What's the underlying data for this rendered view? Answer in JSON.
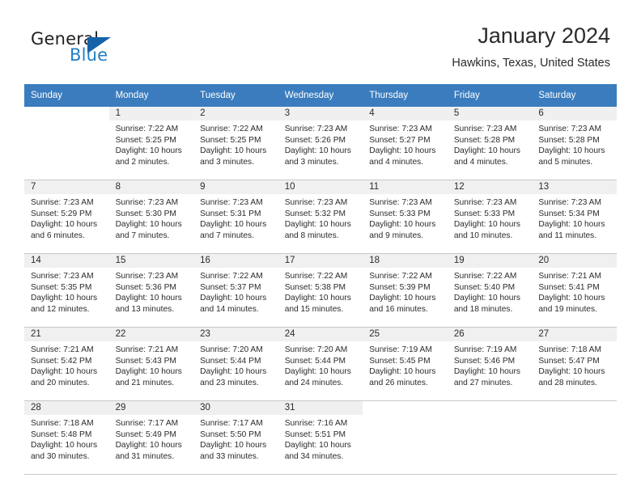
{
  "brand": {
    "name_top": "General",
    "name_bottom": "Blue",
    "triangle_color": "#1463a8",
    "blue_color": "#1f7fc4"
  },
  "header": {
    "title": "January 2024",
    "subtitle": "Hawkins, Texas, United States",
    "header_bg": "#3a7cbe",
    "header_text_color": "#ffffff"
  },
  "weekdays": [
    "Sunday",
    "Monday",
    "Tuesday",
    "Wednesday",
    "Thursday",
    "Friday",
    "Saturday"
  ],
  "labels": {
    "sunrise": "Sunrise:",
    "sunset": "Sunset:",
    "daylight": "Daylight:"
  },
  "weeks": [
    [
      {
        "day": ""
      },
      {
        "day": "1",
        "sunrise": "Sunrise: 7:22 AM",
        "sunset": "Sunset: 5:25 PM",
        "daylight": "Daylight: 10 hours and 2 minutes."
      },
      {
        "day": "2",
        "sunrise": "Sunrise: 7:22 AM",
        "sunset": "Sunset: 5:25 PM",
        "daylight": "Daylight: 10 hours and 3 minutes."
      },
      {
        "day": "3",
        "sunrise": "Sunrise: 7:23 AM",
        "sunset": "Sunset: 5:26 PM",
        "daylight": "Daylight: 10 hours and 3 minutes."
      },
      {
        "day": "4",
        "sunrise": "Sunrise: 7:23 AM",
        "sunset": "Sunset: 5:27 PM",
        "daylight": "Daylight: 10 hours and 4 minutes."
      },
      {
        "day": "5",
        "sunrise": "Sunrise: 7:23 AM",
        "sunset": "Sunset: 5:28 PM",
        "daylight": "Daylight: 10 hours and 4 minutes."
      },
      {
        "day": "6",
        "sunrise": "Sunrise: 7:23 AM",
        "sunset": "Sunset: 5:28 PM",
        "daylight": "Daylight: 10 hours and 5 minutes."
      }
    ],
    [
      {
        "day": "7",
        "sunrise": "Sunrise: 7:23 AM",
        "sunset": "Sunset: 5:29 PM",
        "daylight": "Daylight: 10 hours and 6 minutes."
      },
      {
        "day": "8",
        "sunrise": "Sunrise: 7:23 AM",
        "sunset": "Sunset: 5:30 PM",
        "daylight": "Daylight: 10 hours and 7 minutes."
      },
      {
        "day": "9",
        "sunrise": "Sunrise: 7:23 AM",
        "sunset": "Sunset: 5:31 PM",
        "daylight": "Daylight: 10 hours and 7 minutes."
      },
      {
        "day": "10",
        "sunrise": "Sunrise: 7:23 AM",
        "sunset": "Sunset: 5:32 PM",
        "daylight": "Daylight: 10 hours and 8 minutes."
      },
      {
        "day": "11",
        "sunrise": "Sunrise: 7:23 AM",
        "sunset": "Sunset: 5:33 PM",
        "daylight": "Daylight: 10 hours and 9 minutes."
      },
      {
        "day": "12",
        "sunrise": "Sunrise: 7:23 AM",
        "sunset": "Sunset: 5:33 PM",
        "daylight": "Daylight: 10 hours and 10 minutes."
      },
      {
        "day": "13",
        "sunrise": "Sunrise: 7:23 AM",
        "sunset": "Sunset: 5:34 PM",
        "daylight": "Daylight: 10 hours and 11 minutes."
      }
    ],
    [
      {
        "day": "14",
        "sunrise": "Sunrise: 7:23 AM",
        "sunset": "Sunset: 5:35 PM",
        "daylight": "Daylight: 10 hours and 12 minutes."
      },
      {
        "day": "15",
        "sunrise": "Sunrise: 7:23 AM",
        "sunset": "Sunset: 5:36 PM",
        "daylight": "Daylight: 10 hours and 13 minutes."
      },
      {
        "day": "16",
        "sunrise": "Sunrise: 7:22 AM",
        "sunset": "Sunset: 5:37 PM",
        "daylight": "Daylight: 10 hours and 14 minutes."
      },
      {
        "day": "17",
        "sunrise": "Sunrise: 7:22 AM",
        "sunset": "Sunset: 5:38 PM",
        "daylight": "Daylight: 10 hours and 15 minutes."
      },
      {
        "day": "18",
        "sunrise": "Sunrise: 7:22 AM",
        "sunset": "Sunset: 5:39 PM",
        "daylight": "Daylight: 10 hours and 16 minutes."
      },
      {
        "day": "19",
        "sunrise": "Sunrise: 7:22 AM",
        "sunset": "Sunset: 5:40 PM",
        "daylight": "Daylight: 10 hours and 18 minutes."
      },
      {
        "day": "20",
        "sunrise": "Sunrise: 7:21 AM",
        "sunset": "Sunset: 5:41 PM",
        "daylight": "Daylight: 10 hours and 19 minutes."
      }
    ],
    [
      {
        "day": "21",
        "sunrise": "Sunrise: 7:21 AM",
        "sunset": "Sunset: 5:42 PM",
        "daylight": "Daylight: 10 hours and 20 minutes."
      },
      {
        "day": "22",
        "sunrise": "Sunrise: 7:21 AM",
        "sunset": "Sunset: 5:43 PM",
        "daylight": "Daylight: 10 hours and 21 minutes."
      },
      {
        "day": "23",
        "sunrise": "Sunrise: 7:20 AM",
        "sunset": "Sunset: 5:44 PM",
        "daylight": "Daylight: 10 hours and 23 minutes."
      },
      {
        "day": "24",
        "sunrise": "Sunrise: 7:20 AM",
        "sunset": "Sunset: 5:44 PM",
        "daylight": "Daylight: 10 hours and 24 minutes."
      },
      {
        "day": "25",
        "sunrise": "Sunrise: 7:19 AM",
        "sunset": "Sunset: 5:45 PM",
        "daylight": "Daylight: 10 hours and 26 minutes."
      },
      {
        "day": "26",
        "sunrise": "Sunrise: 7:19 AM",
        "sunset": "Sunset: 5:46 PM",
        "daylight": "Daylight: 10 hours and 27 minutes."
      },
      {
        "day": "27",
        "sunrise": "Sunrise: 7:18 AM",
        "sunset": "Sunset: 5:47 PM",
        "daylight": "Daylight: 10 hours and 28 minutes."
      }
    ],
    [
      {
        "day": "28",
        "sunrise": "Sunrise: 7:18 AM",
        "sunset": "Sunset: 5:48 PM",
        "daylight": "Daylight: 10 hours and 30 minutes."
      },
      {
        "day": "29",
        "sunrise": "Sunrise: 7:17 AM",
        "sunset": "Sunset: 5:49 PM",
        "daylight": "Daylight: 10 hours and 31 minutes."
      },
      {
        "day": "30",
        "sunrise": "Sunrise: 7:17 AM",
        "sunset": "Sunset: 5:50 PM",
        "daylight": "Daylight: 10 hours and 33 minutes."
      },
      {
        "day": "31",
        "sunrise": "Sunrise: 7:16 AM",
        "sunset": "Sunset: 5:51 PM",
        "daylight": "Daylight: 10 hours and 34 minutes."
      },
      {
        "day": ""
      },
      {
        "day": ""
      },
      {
        "day": ""
      }
    ]
  ]
}
